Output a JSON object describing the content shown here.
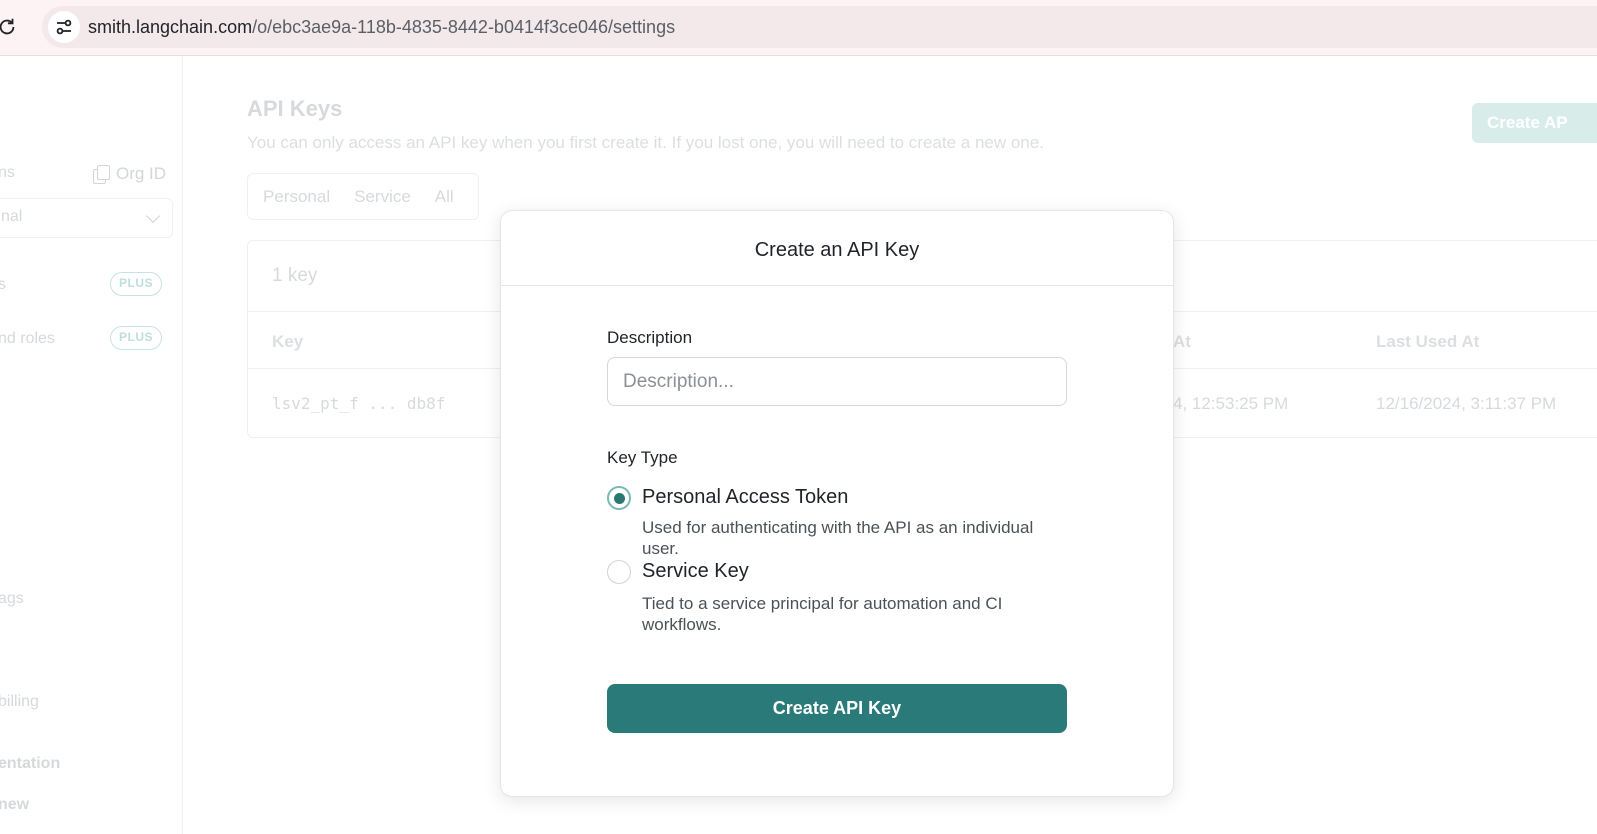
{
  "browser": {
    "url_host": "smith.langchain.com",
    "url_path": "/o/ebc3ae9a-118b-4835-8442-b0414f3ce046/settings"
  },
  "sidebar": {
    "section_label": "ns",
    "org_id_label": "Org ID",
    "org_select_value": "nal",
    "items": [
      {
        "label": "s",
        "badge": "PLUS"
      },
      {
        "label": "nd roles",
        "badge": "PLUS"
      },
      {
        "label": "ags"
      },
      {
        "label": "billing"
      },
      {
        "label": "entation"
      },
      {
        "label": "new"
      }
    ]
  },
  "main": {
    "title": "API Keys",
    "subtitle": "You can only access an API key when you first create it. If you lost one, you will need to create a new one.",
    "create_button": "Create AP",
    "tabs": [
      "Personal",
      "Service",
      "All"
    ],
    "keys_count": "1 key",
    "columns": [
      "Key",
      "At",
      "Last Used At"
    ],
    "rows": [
      {
        "key": "lsv2_pt_f ... db8f",
        "created_at": "4, 12:53:25 PM",
        "last_used_at": "12/16/2024, 3:11:37 PM"
      }
    ]
  },
  "modal": {
    "title": "Create an API Key",
    "description_label": "Description",
    "description_placeholder": "Description...",
    "description_value": "",
    "key_type_label": "Key Type",
    "options": [
      {
        "title": "Personal Access Token",
        "description": "Used for authenticating with the API as an individual user.",
        "selected": true
      },
      {
        "title": "Service Key",
        "description": "Tied to a service principal for automation and CI workflows.",
        "selected": false
      }
    ],
    "submit_label": "Create API Key"
  },
  "colors": {
    "accent": "#297a78",
    "radio_ring": "#79b8b4"
  }
}
